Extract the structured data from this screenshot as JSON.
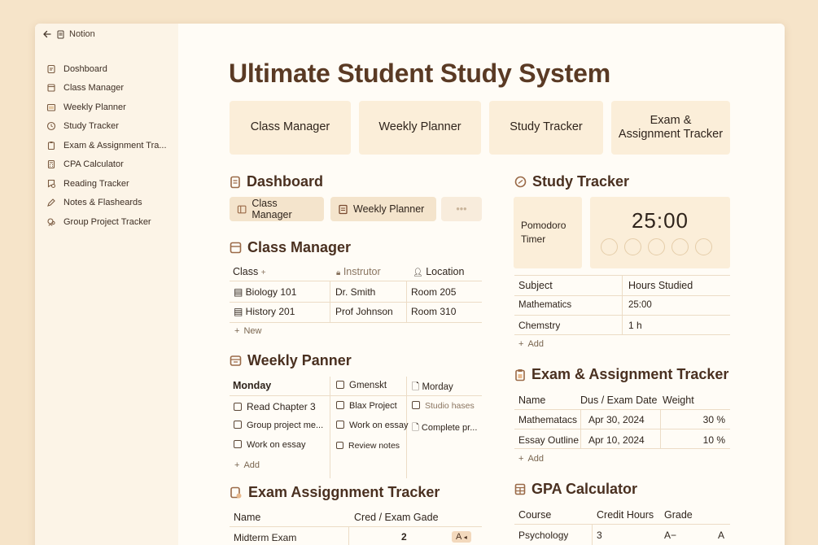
{
  "topbar": {
    "app_name": "Notion"
  },
  "sidebar": {
    "items": [
      {
        "label": "Doshboard"
      },
      {
        "label": "Class Manager"
      },
      {
        "label": "Weekly Planner"
      },
      {
        "label": "Study Tracker"
      },
      {
        "label": "Exam & Assignment Tra..."
      },
      {
        "label": "CPA Calculator"
      },
      {
        "label": "Reading Tracker"
      },
      {
        "label": "Notes & Flasheards"
      },
      {
        "label": "Group Project Tracker"
      }
    ]
  },
  "page": {
    "title": "Ultimate Student Study System"
  },
  "cards": [
    {
      "label": "Class Manager"
    },
    {
      "label": "Weekly Planner"
    },
    {
      "label": "Study Tracker"
    },
    {
      "label": "Exam &\nAssignment Tracker"
    }
  ],
  "dashboard": {
    "title": "Dashboard",
    "chips": [
      "Class Manager",
      "Weekly Planner"
    ],
    "more": "•••"
  },
  "class_manager": {
    "title": "Class Manager",
    "headers": [
      "Class",
      "Instrutor",
      "Location"
    ],
    "rows": [
      [
        "Biology 101",
        "Dr. Smith",
        "Room 205"
      ],
      [
        "History 201",
        "Prof  Johnson",
        "Room 310"
      ]
    ],
    "new_label": "New"
  },
  "weekly_planner": {
    "title": "Weekly Panner",
    "col1_header": "Monday",
    "col2_header": "Gmenskt",
    "col3_header": "Morday",
    "col1": [
      "Read Chapter 3",
      "Group project me...",
      "Work on essay"
    ],
    "col2": [
      "Blax Project",
      "Work on essay",
      "Review notes"
    ],
    "col3": [
      "Studio hases",
      "Complete pr..."
    ],
    "add_label": "Add"
  },
  "exam_assignment_left": {
    "title": "Exam Assiggnment Tracker",
    "headers": [
      "Name",
      "Cred / Exam Gade"
    ],
    "rows": [
      [
        "Midterm Exam",
        "2",
        "A"
      ]
    ]
  },
  "study_tracker": {
    "title": "Study Tracker",
    "pomodoro_label": "Pomodoro\nTimer",
    "timer": "25:00",
    "headers": [
      "Subject",
      "Hours Studied"
    ],
    "rows": [
      [
        "Mathematics",
        "25:00"
      ],
      [
        "Chemstry",
        "1 h"
      ]
    ],
    "add_label": "Add"
  },
  "exam_tracker": {
    "title": "Exam & Assignment Tracker",
    "headers": [
      "Name",
      "Dus / Exam Date",
      "Weight"
    ],
    "rows": [
      [
        "Mathematacs",
        "Apr 30, 2024",
        "30 %"
      ],
      [
        "Essay Outline",
        "Apr 10, 2024",
        "10 %"
      ]
    ],
    "add_label": "Add"
  },
  "gpa": {
    "title": "GPA Calculator",
    "headers": [
      "Course",
      "Credit Hours",
      "Grade"
    ],
    "rows": [
      [
        "Psychology",
        "3",
        "A−",
        "A"
      ]
    ]
  }
}
